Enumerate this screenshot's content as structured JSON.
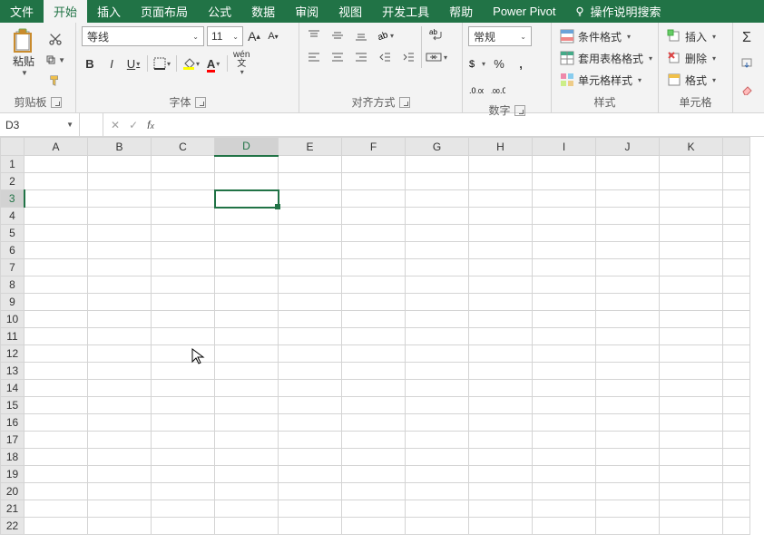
{
  "tabs": [
    "文件",
    "开始",
    "插入",
    "页面布局",
    "公式",
    "数据",
    "审阅",
    "视图",
    "开发工具",
    "帮助",
    "Power Pivot"
  ],
  "active_tab": "开始",
  "tell_me": "操作说明搜索",
  "clipboard": {
    "paste": "粘贴",
    "group": "剪贴板"
  },
  "font": {
    "name": "等线",
    "size": "11",
    "increase": "A",
    "decrease": "A",
    "bold": "B",
    "italic": "I",
    "underline": "U",
    "ruby": "wén",
    "group": "字体"
  },
  "alignment": {
    "wrap": "ab",
    "group": "对齐方式"
  },
  "number": {
    "format": "常规",
    "group": "数字"
  },
  "styles": {
    "cond": "条件格式",
    "table": "套用表格格式",
    "cell": "单元格样式",
    "group": "样式"
  },
  "cells": {
    "insert": "插入",
    "delete": "删除",
    "format": "格式",
    "group": "单元格"
  },
  "namebox": "D3",
  "columns": [
    "A",
    "B",
    "C",
    "D",
    "E",
    "F",
    "G",
    "H",
    "I",
    "J",
    "K"
  ],
  "rows": 22,
  "selected": {
    "col": "D",
    "row": 3
  }
}
